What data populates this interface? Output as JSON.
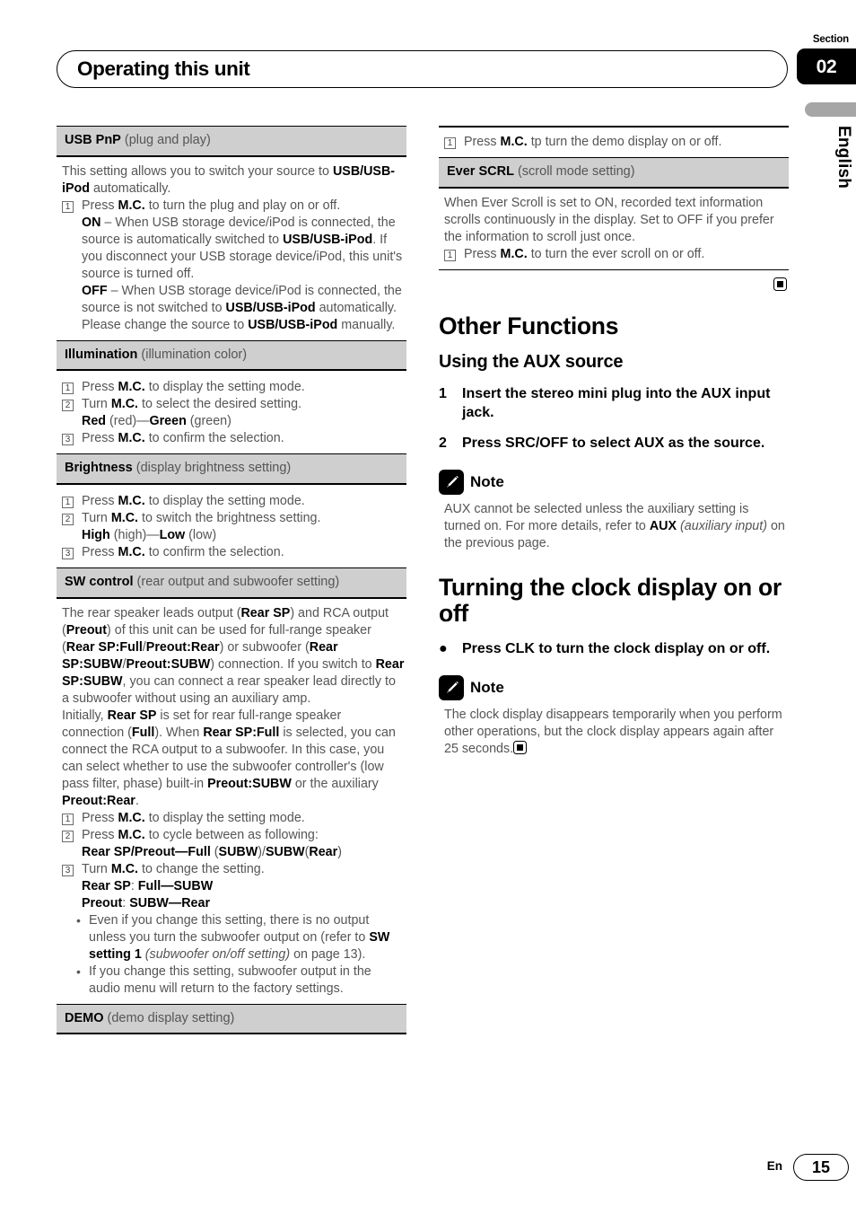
{
  "header": {
    "title": "Operating this unit",
    "section_label": "Section",
    "section_number": "02",
    "language_tab": "English"
  },
  "footer": {
    "lang_code": "En",
    "page_number": "15"
  },
  "left_column": {
    "sections": [
      {
        "id": "usb-pnp",
        "heading_bold": "USB PnP",
        "heading_rest": " (plug and play)"
      },
      {
        "id": "illumination",
        "heading_bold": "Illumination",
        "heading_rest": " (illumination color)"
      },
      {
        "id": "brightness",
        "heading_bold": "Brightness",
        "heading_rest": " (display brightness setting)"
      },
      {
        "id": "sw-control",
        "heading_bold": "SW control",
        "heading_rest": " (rear output and subwoofer setting)"
      },
      {
        "id": "demo",
        "heading_bold": "DEMO",
        "heading_rest": " (demo display setting)"
      }
    ],
    "usb_pnp": {
      "intro_a": "This setting allows you to switch your source to ",
      "intro_b": "USB/USB-iPod",
      "intro_c": " automatically.",
      "step1_num": "1",
      "step1_a": "Press ",
      "step1_b": "M.C.",
      "step1_c": " to turn the plug and play on or off.",
      "on_label": "ON",
      "on_text_a": " – When USB storage device/iPod is connected, the source is automatically switched to ",
      "on_text_b": "USB/USB-iPod",
      "on_text_c": ". If you disconnect your USB storage device/iPod, this unit's source is turned off.",
      "off_label": "OFF",
      "off_text_a": " – When USB storage device/iPod is connected, the source is not switched to ",
      "off_text_b": "USB/USB-iPod",
      "off_text_c": " automatically. Please change the source to ",
      "off_text_d": "USB/USB-iPod",
      "off_text_e": " manually."
    },
    "illumination": {
      "s1_num": "1",
      "s1_a": "Press ",
      "s1_b": "M.C.",
      "s1_c": " to display the setting mode.",
      "s2_num": "2",
      "s2_a": "Turn ",
      "s2_b": "M.C.",
      "s2_c": " to select the desired setting.",
      "s2_opt_a": "Red",
      "s2_opt_b": " (red)—",
      "s2_opt_c": "Green",
      "s2_opt_d": " (green)",
      "s3_num": "3",
      "s3_a": "Press ",
      "s3_b": "M.C.",
      "s3_c": " to confirm the selection."
    },
    "brightness": {
      "s1_num": "1",
      "s1_a": "Press ",
      "s1_b": "M.C.",
      "s1_c": " to display the setting mode.",
      "s2_num": "2",
      "s2_a": "Turn ",
      "s2_b": "M.C.",
      "s2_c": " to switch the brightness setting.",
      "s2_opt_a": "High",
      "s2_opt_b": " (high)—",
      "s2_opt_c": "Low",
      "s2_opt_d": " (low)",
      "s3_num": "3",
      "s3_a": "Press ",
      "s3_b": "M.C.",
      "s3_c": " to confirm the selection."
    },
    "sw_control": {
      "p1_01": "The rear speaker leads output (",
      "p1_02": "Rear SP",
      "p1_03": ") and RCA output (",
      "p1_04": "Preout",
      "p1_05": ") of this unit can be used for full-range speaker (",
      "p1_06": "Rear SP",
      "p1_07": ":",
      "p1_08": "Full",
      "p1_09": "/",
      "p1_10": "Preout",
      "p1_11": ":",
      "p1_12": "Rear",
      "p1_13": ") or subwoofer (",
      "p1_14": "Rear SP",
      "p1_15": ":",
      "p1_16": "SUBW",
      "p1_17": "/",
      "p1_18": "Preout",
      "p1_19": ":",
      "p1_20": "SUBW",
      "p1_21": ") connection. If you switch to ",
      "p1_22": "Rear SP",
      "p1_23": ":",
      "p1_24": "SUBW",
      "p1_25": ", you can connect a rear speaker lead directly to a subwoofer without using an auxiliary amp.",
      "p2_01": "Initially, ",
      "p2_02": "Rear SP",
      "p2_03": " is set for rear full-range speaker connection (",
      "p2_04": "Full",
      "p2_05": "). When ",
      "p2_06": "Rear SP",
      "p2_07": ":",
      "p2_08": "Full",
      "p2_09": " is selected, you can connect the RCA output to a subwoofer. In this case, you can select whether to use the subwoofer controller's (low pass filter, phase) built-in ",
      "p2_10": "Preout",
      "p2_11": ":",
      "p2_12": "SUBW",
      "p2_13": " or the auxiliary ",
      "p2_14": "Preout",
      "p2_15": ":",
      "p2_16": "Rear",
      "p2_17": ".",
      "s1_num": "1",
      "s1_a": "Press ",
      "s1_b": "M.C.",
      "s1_c": " to display the setting mode.",
      "s2_num": "2",
      "s2_a": "Press ",
      "s2_b": "M.C.",
      "s2_c": " to cycle between as following:",
      "s2_opt_a": "Rear SP/Preout—Full",
      "s2_opt_b": " (",
      "s2_opt_c": "SUBW",
      "s2_opt_d": ")/",
      "s2_opt_e": "SUBW",
      "s2_opt_f": "(",
      "s2_opt_g": "Rear",
      "s2_opt_h": ")",
      "s3_num": "3",
      "s3_a": "Turn ",
      "s3_b": "M.C.",
      "s3_c": " to change the setting.",
      "s3_line1_a": "Rear SP",
      "s3_line1_b": ": ",
      "s3_line1_c": "Full—SUBW",
      "s3_line2_a": "Preout",
      "s3_line2_b": ": ",
      "s3_line2_c": "SUBW—Rear",
      "b1_a": "Even if you change this setting, there is no output unless you turn the subwoofer output on (refer to ",
      "b1_b": "SW setting 1",
      "b1_c": " ",
      "b1_d": "(subwoofer on/off setting)",
      "b1_e": " on page 13).",
      "b2_a": "If you change this setting, subwoofer output in the audio menu will return to the factory settings.",
      "bullet_glyph": "•"
    }
  },
  "right_column": {
    "demo_step": {
      "num": "1",
      "a": "Press ",
      "b": "M.C.",
      "c": " tp turn the demo display on or off."
    },
    "ever_scrl": {
      "heading_bold": "Ever SCRL",
      "heading_rest": " (scroll mode setting)",
      "body": "When Ever Scroll is set to ON, recorded text information scrolls continuously in the display. Set to OFF if you prefer the information to scroll just once.",
      "step_num": "1",
      "step_a": "Press ",
      "step_b": "M.C.",
      "step_c": " to turn the ever scroll on or off."
    },
    "other_functions": {
      "title": "Other Functions",
      "aux_title": "Using the AUX source",
      "step1_num": "1",
      "step1_text": "Insert the stereo mini plug into the AUX input jack.",
      "step2_num": "2",
      "step2_text": "Press SRC/OFF to select AUX as the source.",
      "note_title": "Note",
      "note_a": "AUX cannot be selected unless the auxiliary setting is turned on. For more details, refer to ",
      "note_b": "AUX",
      "note_c": " ",
      "note_d": "(auxiliary input)",
      "note_e": " on the previous page."
    },
    "clock": {
      "title": "Turning the clock display on or off",
      "bullet_glyph": "●",
      "bullet_text": "Press CLK to turn the clock display on or off.",
      "note_title": "Note",
      "note_text": "The clock display disappears temporarily when you perform other operations, but the clock display appears again after 25 seconds."
    }
  }
}
